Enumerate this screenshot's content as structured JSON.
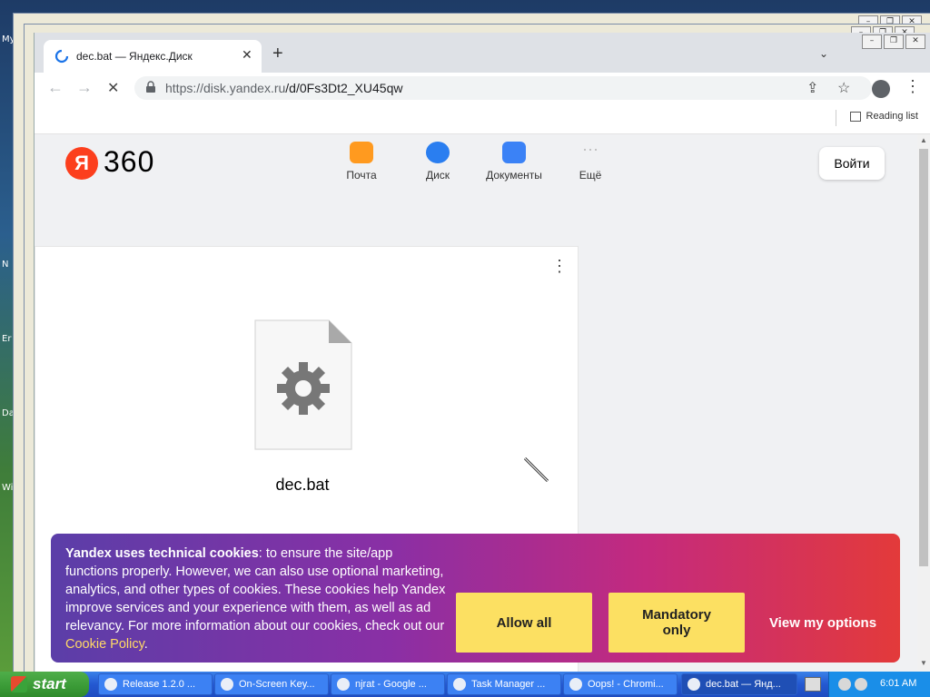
{
  "desktop": {
    "labels": [
      "My",
      "N",
      "Er",
      "Da",
      "Wir"
    ]
  },
  "browser": {
    "tab": {
      "title": "dec.bat — Яндекс.Диск",
      "close": "✕"
    },
    "new_tab": "+",
    "tab_search": "⌄",
    "window_buttons": [
      "–",
      "❐",
      "✕"
    ],
    "url_host": "https://disk.yandex.ru",
    "url_path": "/d/0Fs3Dt2_XU45qw",
    "reading_list": "Reading list",
    "nav": {
      "back": "←",
      "forward": "→",
      "reload": "✕"
    },
    "omni_icons": {
      "share": "⇪",
      "star": "☆",
      "menu": "⋮"
    }
  },
  "yandex360": {
    "logo_letter": "Я",
    "logo_text": "360",
    "services": [
      {
        "label": "Почта",
        "icon": "mail-icon",
        "color": "#ff9a1f"
      },
      {
        "label": "Диск",
        "icon": "disk-icon",
        "color": "#2a7ef0"
      },
      {
        "label": "Документы",
        "icon": "docs-icon",
        "color": "#3b82f6"
      },
      {
        "label": "Ещё",
        "icon": "more-icon",
        "color": "#c8c8c8"
      }
    ],
    "login_label": "Войти"
  },
  "file": {
    "name": "dec.bat",
    "menu": "⋮"
  },
  "cookie_banner": {
    "heading": "Yandex uses technical cookies",
    "body": ": to ensure the site/app functions properly. However, we can also use optional marketing, analytics, and other types of cookies. These cookies help Yandex improve services and your experience with them, as well as ad relevancy. For more information about our cookies, check out our ",
    "link": "Cookie Policy",
    "end": ".",
    "allow_all": "Allow all",
    "mandatory_only": "Mandatory only",
    "view_options": "View my options"
  },
  "taskbar": {
    "start_label": "start",
    "tasks": [
      {
        "label": "Release 1.2.0 ..."
      },
      {
        "label": "On-Screen Key..."
      },
      {
        "label": "njrat - Google ..."
      },
      {
        "label": "Task Manager ..."
      },
      {
        "label": "Oops! - Chromi..."
      },
      {
        "label": "dec.bat — Янд..."
      }
    ],
    "clock": "6:01 AM"
  },
  "colors": {
    "yandex_red": "#fc3f1d",
    "cookie_button": "#fce062"
  }
}
